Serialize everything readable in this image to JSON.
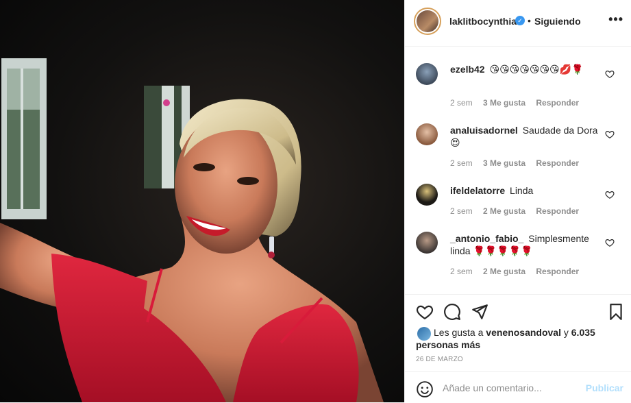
{
  "post_image": {
    "description_icon": "selfie-photo"
  },
  "header": {
    "username": "laklitbocynthia",
    "verified_icon": "verified-badge-icon",
    "separator": "•",
    "follow_label": "Siguiendo",
    "more_icon": "more-options-icon",
    "more_glyph": "•••"
  },
  "comments": [
    {
      "username": "ezelb42",
      "text": "😘😘😘😘😘😘😘💋🌹",
      "age": "2 sem",
      "likes": "3 Me gusta",
      "reply": "Responder"
    },
    {
      "username": "analuisadornel",
      "text": "Saudade da Dora 😍",
      "age": "2 sem",
      "likes": "3 Me gusta",
      "reply": "Responder"
    },
    {
      "username": "ifeldelatorre",
      "text": "Linda",
      "age": "2 sem",
      "likes": "2 Me gusta",
      "reply": "Responder"
    },
    {
      "username": "_antonio_fabio_",
      "text": "Simplesmente linda 🌹🌹🌹🌹🌹",
      "age": "2 sem",
      "likes": "2 Me gusta",
      "reply": "Responder"
    }
  ],
  "likes": {
    "prefix": "Les gusta a",
    "user": "venenosandoval",
    "conjunction": "y",
    "others": "6.035 personas más"
  },
  "date": "26 DE MARZO",
  "add_comment": {
    "placeholder": "Añade un comentario...",
    "publish_label": "Publicar"
  },
  "colors": {
    "accent": "#0095f6",
    "publish_disabled": "#b2dffc",
    "meta_gray": "#8e8e8e",
    "text": "#262626",
    "dress_red": "#d81b3a"
  }
}
